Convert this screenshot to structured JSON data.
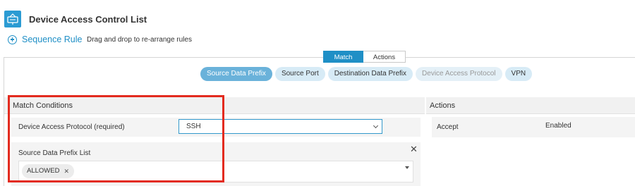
{
  "header": {
    "title": "Device Access Control List",
    "sequence_rule_label": "Sequence Rule",
    "hint": "Drag and drop to re-arrange rules",
    "app_icon": "network-device-icon"
  },
  "tabs": [
    {
      "label": "Match",
      "active": true
    },
    {
      "label": "Actions",
      "active": false
    }
  ],
  "match_types": [
    {
      "label": "Source Data Prefix",
      "state": "active"
    },
    {
      "label": "Source Port",
      "state": "normal"
    },
    {
      "label": "Destination Data Prefix",
      "state": "normal"
    },
    {
      "label": "Device Access Protocol",
      "state": "disabled"
    },
    {
      "label": "VPN",
      "state": "normal"
    }
  ],
  "match_conditions": {
    "title": "Match Conditions",
    "protocol": {
      "label": "Device Access Protocol (required)",
      "value": "SSH"
    },
    "source_prefix": {
      "label": "Source Data Prefix List",
      "tags": [
        "ALLOWED"
      ]
    }
  },
  "actions_panel": {
    "title": "Actions",
    "rows": [
      {
        "label": "Accept",
        "value": "Enabled"
      }
    ]
  },
  "colors": {
    "accent": "#1f8fc6",
    "highlight": "#e32b1f",
    "pill": "#d7ebf6",
    "pill_active": "#6ab2da"
  }
}
